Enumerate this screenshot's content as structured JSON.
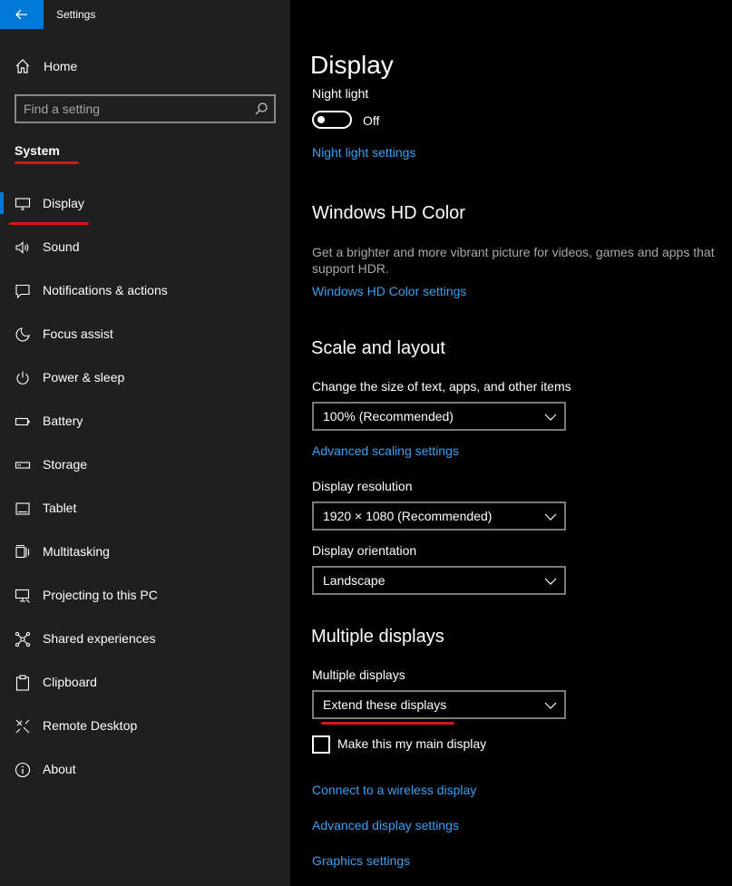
{
  "window": {
    "title": "Settings"
  },
  "sidebar": {
    "home_label": "Home",
    "search_placeholder": "Find a setting",
    "section": "System",
    "items": [
      {
        "label": "Display",
        "icon": "monitor-icon",
        "active": true
      },
      {
        "label": "Sound",
        "icon": "speaker-icon"
      },
      {
        "label": "Notifications & actions",
        "icon": "notification-icon"
      },
      {
        "label": "Focus assist",
        "icon": "moon-icon"
      },
      {
        "label": "Power & sleep",
        "icon": "power-icon"
      },
      {
        "label": "Battery",
        "icon": "battery-icon"
      },
      {
        "label": "Storage",
        "icon": "storage-icon"
      },
      {
        "label": "Tablet",
        "icon": "tablet-icon"
      },
      {
        "label": "Multitasking",
        "icon": "multitasking-icon"
      },
      {
        "label": "Projecting to this PC",
        "icon": "projecting-icon"
      },
      {
        "label": "Shared experiences",
        "icon": "shared-icon"
      },
      {
        "label": "Clipboard",
        "icon": "clipboard-icon"
      },
      {
        "label": "Remote Desktop",
        "icon": "remote-desktop-icon"
      },
      {
        "label": "About",
        "icon": "info-icon"
      }
    ]
  },
  "main": {
    "title": "Display",
    "night_light": {
      "label": "Night light",
      "state": "Off",
      "link": "Night light settings"
    },
    "hd_color": {
      "heading": "Windows HD Color",
      "description": "Get a brighter and more vibrant picture for videos, games and apps that support HDR.",
      "link": "Windows HD Color settings"
    },
    "scale": {
      "heading": "Scale and layout",
      "size_label": "Change the size of text, apps, and other items",
      "size_value": "100% (Recommended)",
      "advanced_link": "Advanced scaling settings",
      "resolution_label": "Display resolution",
      "resolution_value": "1920 × 1080 (Recommended)",
      "orientation_label": "Display orientation",
      "orientation_value": "Landscape"
    },
    "multiple": {
      "heading": "Multiple displays",
      "label": "Multiple displays",
      "value": "Extend these displays",
      "main_display_label": "Make this my main display",
      "main_display_checked": false
    },
    "links": {
      "wireless": "Connect to a wireless display",
      "advanced_display": "Advanced display settings",
      "graphics": "Graphics settings"
    }
  },
  "colors": {
    "accent": "#0078d7",
    "link": "#3aa0f3",
    "annotation": "#d1181b",
    "sidebar_bg": "#1f1f1f"
  }
}
